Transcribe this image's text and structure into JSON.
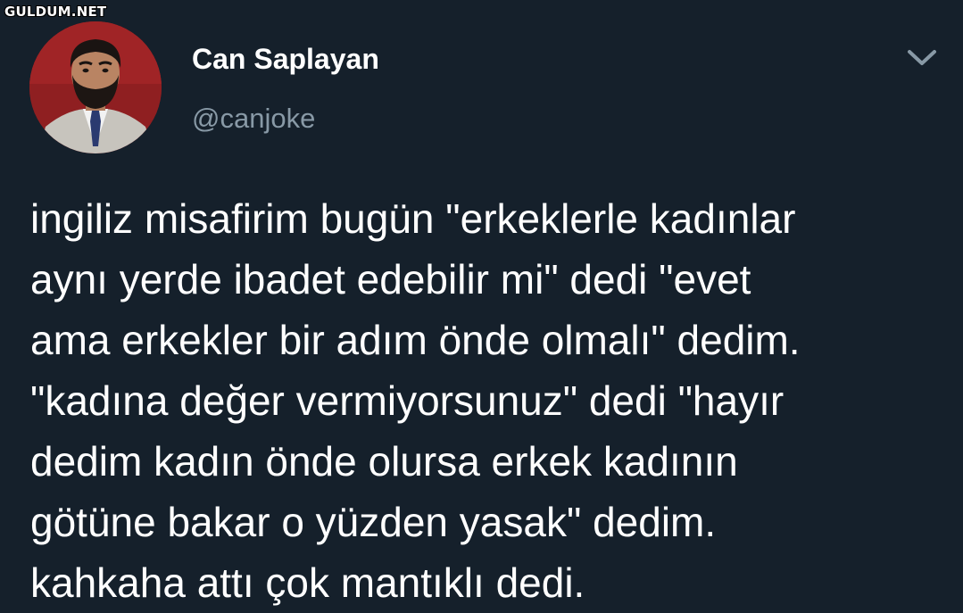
{
  "watermark": "GULDUM.NET",
  "author": {
    "display_name": "Can Saplayan",
    "handle": "@canjoke",
    "avatar": "user-avatar-photo"
  },
  "menu_icon": "chevron-down-icon",
  "tweet": {
    "lines": [
      "ingiliz misafirim bugün \"erkeklerle kadınlar",
      "aynı yerde ibadet edebilir mi\" dedi \"evet",
      "ama erkekler bir adım önde olmalı\" dedim.",
      "\"kadına değer vermiyorsunuz\" dedi \"hayır",
      "dedim kadın önde olursa erkek kadının",
      "götüne bakar o yüzden yasak\" dedim.",
      "kahkaha attı çok mantıklı dedi."
    ]
  },
  "colors": {
    "background": "#15202b",
    "secondary_text": "#8899a6",
    "avatar_backdrop": "#8f1f21"
  }
}
